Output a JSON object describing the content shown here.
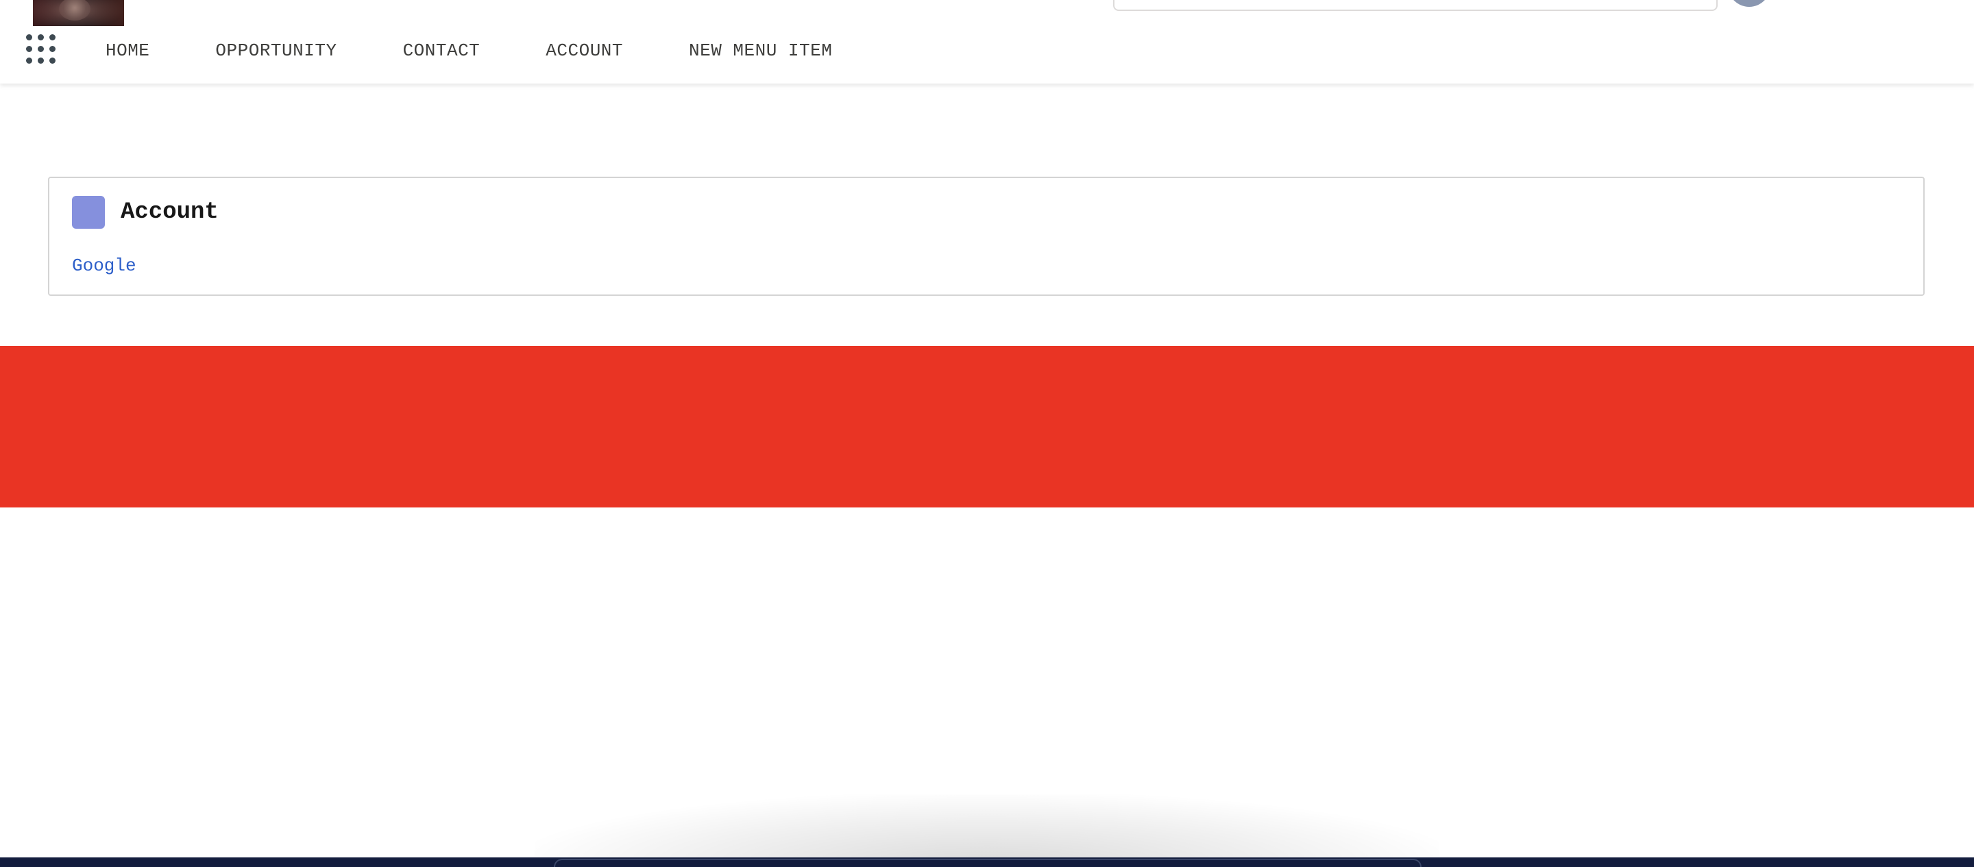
{
  "header": {
    "logo_alt": "logo",
    "search": {
      "placeholder": ""
    },
    "nav": {
      "items": [
        {
          "label": "HOME"
        },
        {
          "label": "OPPORTUNITY"
        },
        {
          "label": "CONTACT"
        },
        {
          "label": "ACCOUNT"
        },
        {
          "label": "NEW MENU ITEM"
        }
      ]
    },
    "icons": {
      "app_launcher": "waffle-grid-icon"
    }
  },
  "account_card": {
    "title": "Account",
    "icon": "account-icon",
    "icon_color": "#8590dd",
    "link_label": "Google",
    "link_color": "#2d5fc9"
  },
  "banner": {
    "color": "#e93424"
  },
  "footer": {
    "color": "#131d3e"
  }
}
